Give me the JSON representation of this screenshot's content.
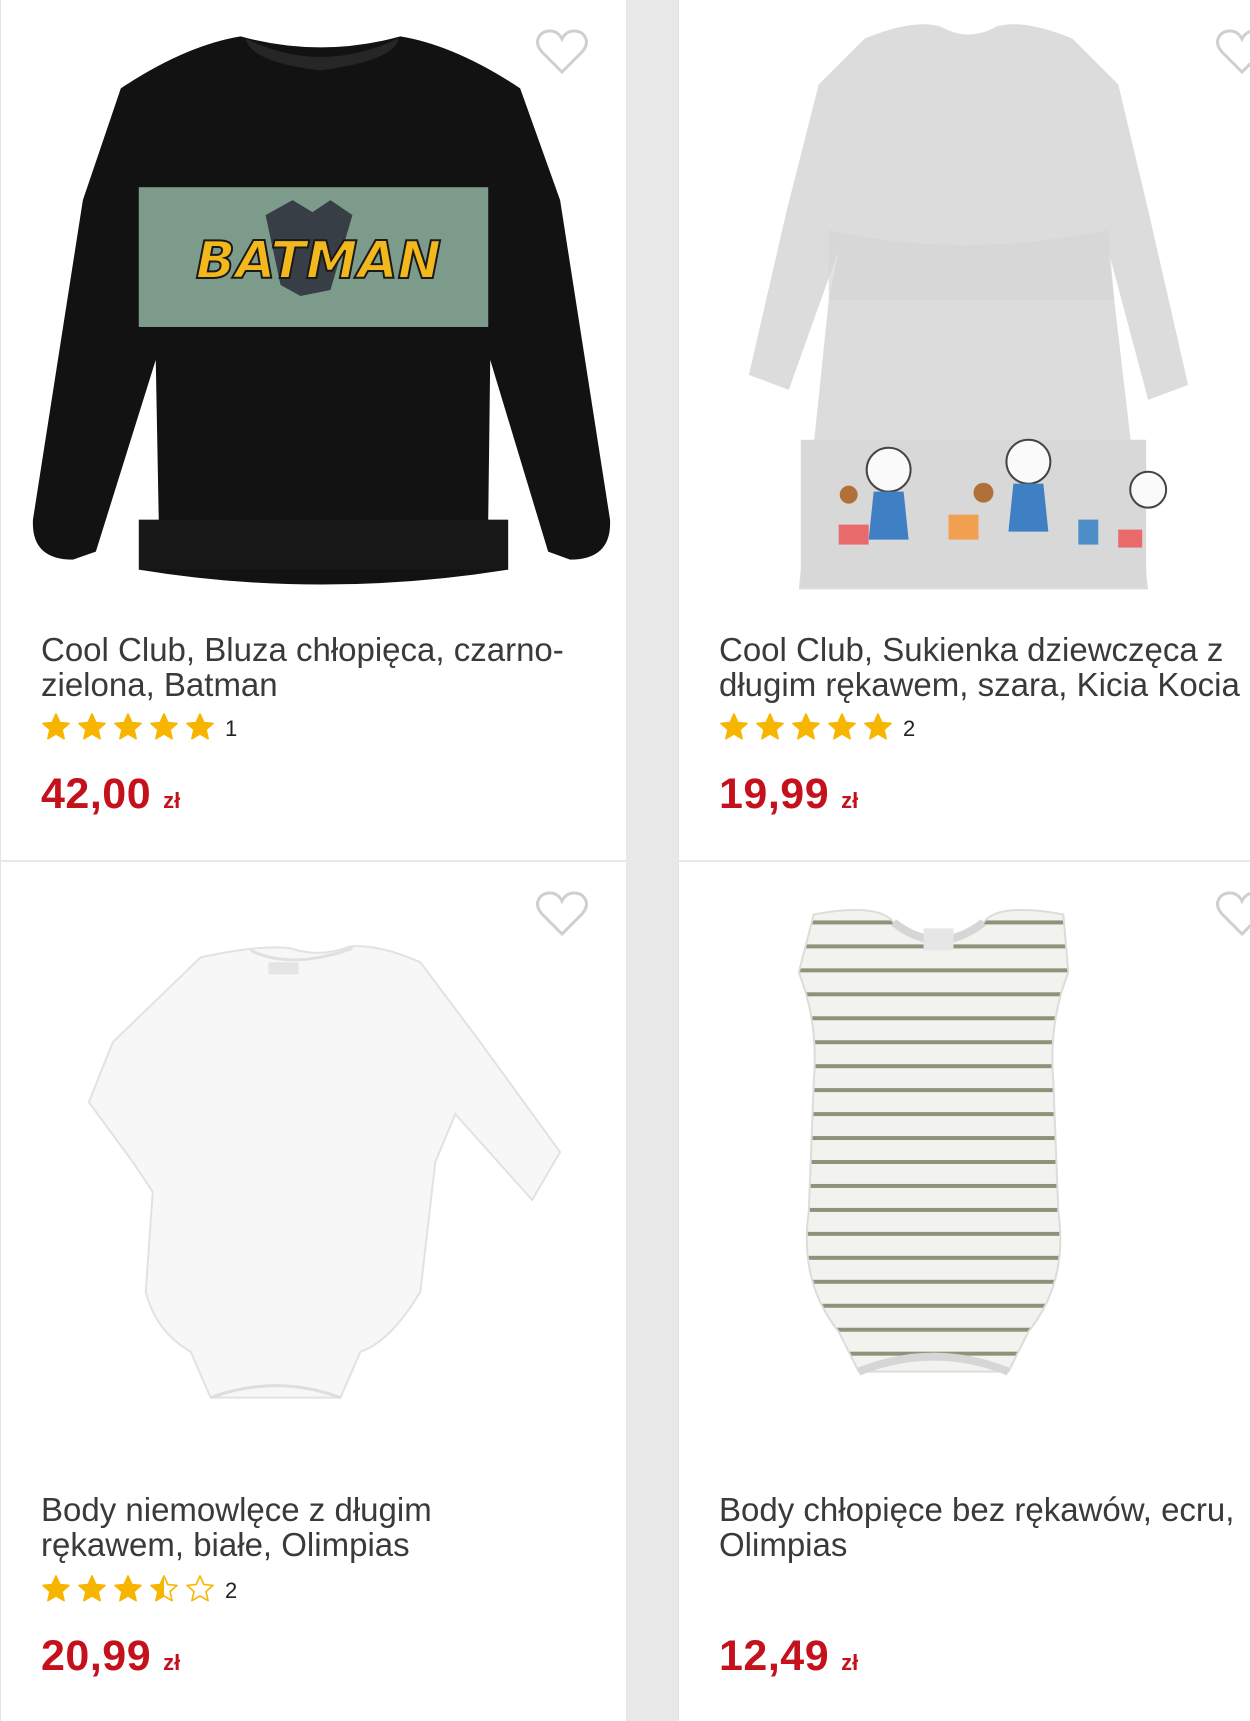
{
  "products": [
    {
      "title_line1": "Cool Club, Bluza chłopięca, czarno-",
      "title_line2": "zielona, Batman",
      "rating": 5,
      "review_count": "1",
      "price": "42,00",
      "currency": "zł",
      "print_text": "BATMAN",
      "image": "black-batman-sweatshirt"
    },
    {
      "title_line1": "Cool Club, Sukienka dziewczęca z",
      "title_line2": "długim rękawem, szara, Kicia Kocia",
      "rating": 5,
      "review_count": "2",
      "price": "19,99",
      "currency": "zł",
      "image": "grey-long-sleeve-dress-kitten-print"
    },
    {
      "title_line1": "Body niemowlęce z długim",
      "title_line2": "rękawem, białe, Olimpias",
      "rating": 3.5,
      "review_count": "2",
      "price": "20,99",
      "currency": "zł",
      "image": "white-long-sleeve-bodysuit"
    },
    {
      "title_line1": "Body chłopięce bez rękawów, ecru,",
      "title_line2": "Olimpias",
      "rating": null,
      "review_count": null,
      "price": "12,49",
      "currency": "zł",
      "image": "striped-sleeveless-bodysuit"
    }
  ],
  "colors": {
    "price": "#c4111c",
    "star": "#f7b500",
    "title": "#3a3a3a",
    "heart_outline": "#cfcfcf"
  },
  "icons": {
    "favorite": "heart-outline-icon",
    "rating": "star-icon"
  }
}
